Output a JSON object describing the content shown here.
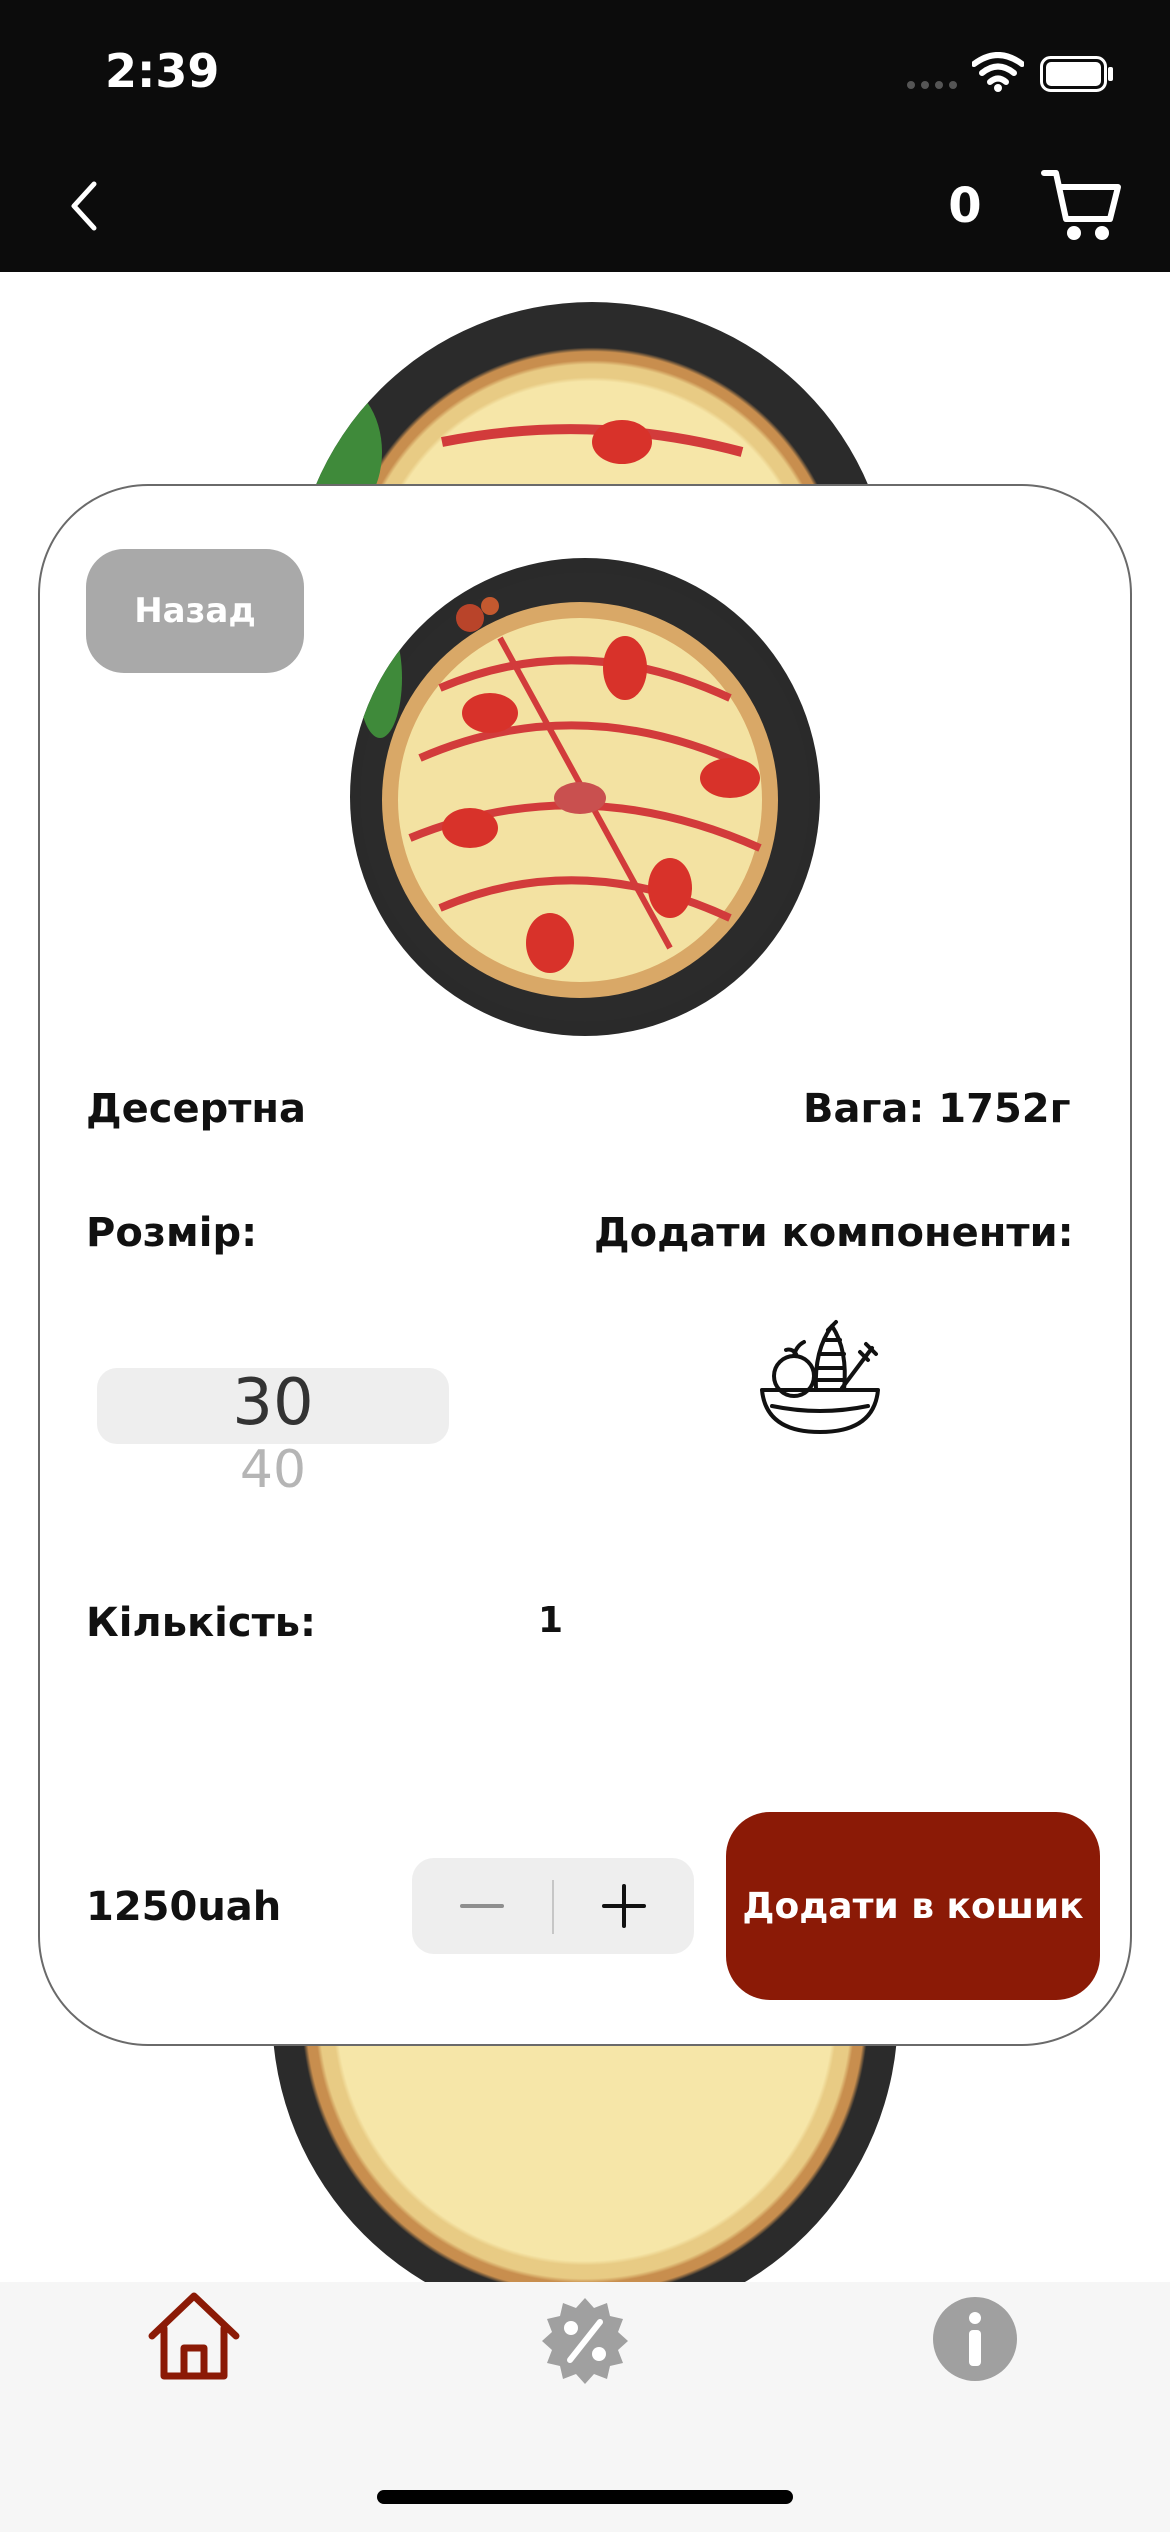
{
  "status_bar": {
    "time": "2:39"
  },
  "nav": {
    "cart_count": "0"
  },
  "product": {
    "name": "Десертна",
    "weight": "Вага: 1752г",
    "size_label": "Розмір:",
    "add_components_label": "Додати компоненти:",
    "size_picker": {
      "selected": "30",
      "next": "40"
    },
    "quantity_label": "Кількість:",
    "quantity": "1",
    "price": "1250uah"
  },
  "buttons": {
    "back": "Назад",
    "add_to_cart": "Додати в кошик"
  },
  "tabs": [
    {
      "icon": "home-icon",
      "active": true
    },
    {
      "icon": "discount-icon",
      "active": false
    },
    {
      "icon": "info-icon",
      "active": false
    }
  ],
  "colors": {
    "accent": "#8b1a06",
    "topbar": "#0c0c0c",
    "back_button": "#a9a9a9",
    "tab_inactive": "#a0a0a0"
  }
}
